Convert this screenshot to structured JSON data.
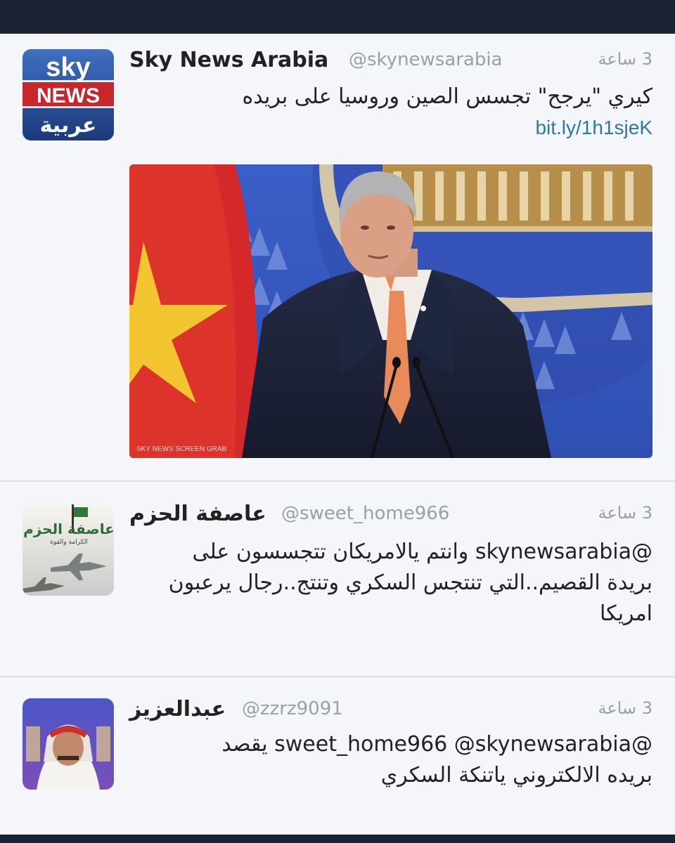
{
  "tweets": [
    {
      "name": "Sky News Arabia",
      "handle": "@skynewsarabia",
      "time": "3 ساعة",
      "text": "كيري \"يرجح\" تجسس الصين وروسيا على بريده",
      "link": "bit.ly/1h1sjeK",
      "avatar": {
        "line1": "sky",
        "line2": "NEWS",
        "line3": "عربية"
      },
      "media": {
        "caption": "SKY NEWS SCREEN GRAB"
      }
    },
    {
      "name": "عاصفة الحزم",
      "handle": "@sweet_home966",
      "time": "3 ساعة",
      "text_lines": [
        "@skynewsarabia وانتم يالامريكان تتجسسون على",
        "بريدة القصيم..التي تنتجس السكري وتنتج..رجال يرعبون",
        "امريكا"
      ],
      "avatar": {
        "title": "عاصفة الحزم",
        "subtitle": "الكرامة والقوة"
      }
    },
    {
      "name": "عبدالعزيز",
      "handle": "@zzrz9091",
      "time": "3 ساعة",
      "text_lines": [
        "@sweet_home966 @skynewsarabia يقصد",
        "بريده الالكتروني ياتنكة السكري"
      ]
    }
  ],
  "colors": {
    "topbar": "#1b2233",
    "link": "#2b7aa7",
    "muted": "#9aa0a8"
  }
}
